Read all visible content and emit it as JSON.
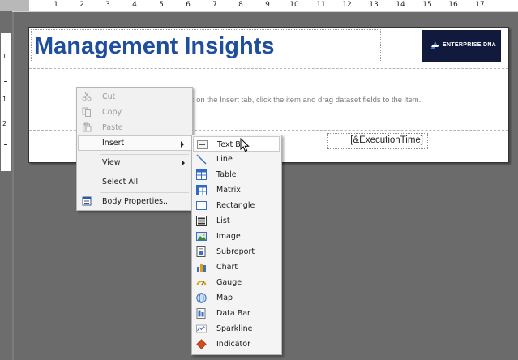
{
  "ruler": {
    "top_numbers": [
      "1",
      "2",
      "3",
      "4",
      "5",
      "6",
      "7",
      "8",
      "9",
      "10",
      "11",
      "12",
      "13",
      "14",
      "15",
      "16",
      "17"
    ],
    "left_numbers": [
      "1",
      "2"
    ]
  },
  "report": {
    "title": "Management Insights",
    "logo_text": "ENTERPRISE DNA",
    "body_hint": "rt: on the Insert tab, click the item and drag dataset fields to the item.",
    "execution_time": "[&ExecutionTime]"
  },
  "context_menu": {
    "cut": "Cut",
    "copy": "Copy",
    "paste": "Paste",
    "insert": "Insert",
    "view": "View",
    "select_all": "Select All",
    "body_properties": "Body Properties..."
  },
  "insert_submenu": [
    {
      "label": "Text Bo",
      "icon": "textbox-icon"
    },
    {
      "label": "Line",
      "icon": "line-icon"
    },
    {
      "label": "Table",
      "icon": "table-icon"
    },
    {
      "label": "Matrix",
      "icon": "matrix-icon"
    },
    {
      "label": "Rectangle",
      "icon": "rectangle-icon"
    },
    {
      "label": "List",
      "icon": "list-icon"
    },
    {
      "label": "Image",
      "icon": "image-icon"
    },
    {
      "label": "Subreport",
      "icon": "subreport-icon"
    },
    {
      "label": "Chart",
      "icon": "chart-icon"
    },
    {
      "label": "Gauge",
      "icon": "gauge-icon"
    },
    {
      "label": "Map",
      "icon": "map-icon"
    },
    {
      "label": "Data Bar",
      "icon": "databar-icon"
    },
    {
      "label": "Sparkline",
      "icon": "sparkline-icon"
    },
    {
      "label": "Indicator",
      "icon": "indicator-icon"
    }
  ],
  "colors": {
    "title": "#1f4e9c",
    "logo_bg": "#111a3c",
    "canvas": "#6d6d6d"
  }
}
